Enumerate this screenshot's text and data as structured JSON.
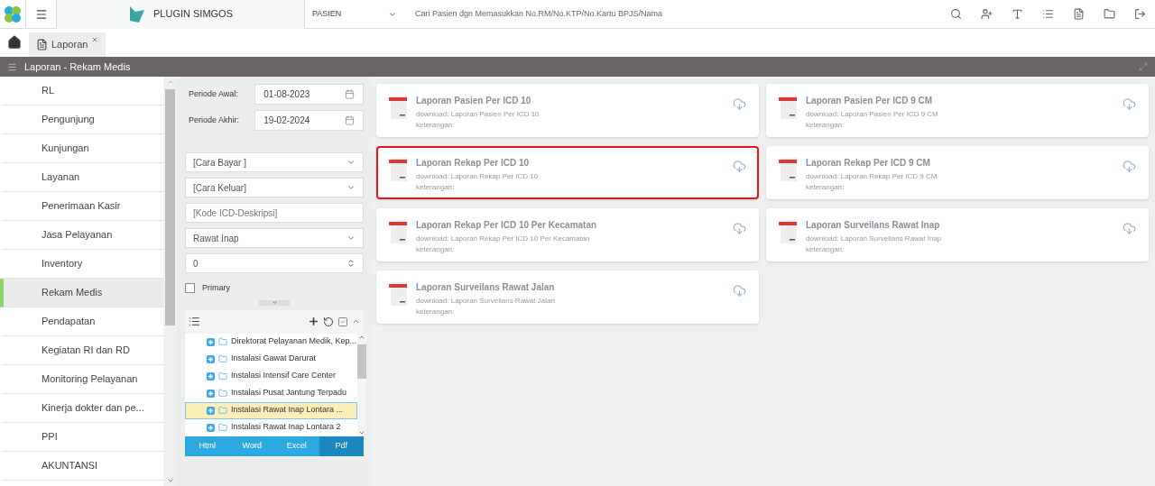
{
  "header": {
    "app_title": "PLUGIN SIMGOS",
    "search_type": "PASIEN",
    "search_placeholder": "Cari Pasien dgn Memasukkan No.RM/No.KTP/No.Kartu BPJS/Nama"
  },
  "tabs": [
    {
      "label": "Laporan",
      "selected": true
    }
  ],
  "panel_title": "Laporan - Rekam Medis",
  "sidebar": {
    "items": [
      {
        "label": "RL",
        "selected": false
      },
      {
        "label": "Pengunjung",
        "selected": false
      },
      {
        "label": "Kunjungan",
        "selected": false
      },
      {
        "label": "Layanan",
        "selected": false
      },
      {
        "label": "Penerimaan Kasir",
        "selected": false
      },
      {
        "label": "Jasa Pelayanan",
        "selected": false
      },
      {
        "label": "Inventory",
        "selected": false
      },
      {
        "label": "Rekam Medis",
        "selected": true
      },
      {
        "label": "Pendapatan",
        "selected": false
      },
      {
        "label": "Kegiatan RI dan RD",
        "selected": false
      },
      {
        "label": "Monitoring Pelayanan",
        "selected": false
      },
      {
        "label": "Kinerja dokter dan pe...",
        "selected": false
      },
      {
        "label": "PPI",
        "selected": false
      },
      {
        "label": "AKUNTANSI",
        "selected": false
      }
    ]
  },
  "filters": {
    "dates": [
      {
        "label": "Periode Awal:",
        "value": "01-08-2023"
      },
      {
        "label": "Periode Akhir:",
        "value": "19-02-2024"
      }
    ],
    "fields": [
      {
        "kind": "select",
        "placeholder": "[Cara Bayar ]"
      },
      {
        "kind": "select",
        "placeholder": "[Cara Keluar]"
      },
      {
        "kind": "text",
        "placeholder": "[Kode ICD-Deskripsi]"
      },
      {
        "kind": "select",
        "value": "Rawat Inap"
      },
      {
        "kind": "number",
        "value": "0"
      }
    ],
    "primary": {
      "label": "Primary",
      "checked": false
    }
  },
  "tree": {
    "items": [
      {
        "label": "Direktorat Pelayanan Medik, Kep...",
        "selected": false
      },
      {
        "label": "Instalasi Gawat Darurat",
        "selected": false
      },
      {
        "label": "Instalasi Intensif Care Center",
        "selected": false
      },
      {
        "label": "Instalasi Pusat Jantung Terpadu",
        "selected": false
      },
      {
        "label": "Instalasi Rawat Inap Lontara ...",
        "selected": true
      },
      {
        "label": "Instalasi Rawat Inap Lontara 2",
        "selected": false
      }
    ]
  },
  "formats": [
    {
      "label": "Html",
      "selected": false
    },
    {
      "label": "Word",
      "selected": false
    },
    {
      "label": "Excel",
      "selected": false
    },
    {
      "label": "Pdf",
      "selected": true
    }
  ],
  "reports": [
    {
      "title": "Laporan Pasien Per ICD 10",
      "download": "download: Laporan Pasien Per ICD 10",
      "note": "keterangan:",
      "selected": false
    },
    {
      "title": "Laporan Pasien Per ICD 9 CM",
      "download": "download: Laporan Pasien Per ICD 9 CM",
      "note": "keterangan:",
      "selected": false
    },
    {
      "title": "Laporan Rekap Per ICD 10",
      "download": "download: Laporan Rekap Per ICD 10",
      "note": "keterangan:",
      "selected": true
    },
    {
      "title": "Laporan Rekap Per ICD 9 CM",
      "download": "download: Laporan Rekap Per ICD 9 CM",
      "note": "keterangan:",
      "selected": false
    },
    {
      "title": "Laporan Rekap Per ICD 10 Per Kecamatan",
      "download": "download: Laporan Rekap Per ICD 10 Per Kecamatan",
      "note": "keterangan:",
      "selected": false
    },
    {
      "title": "Laporan Surveilans Rawat Inap",
      "download": "download: Laporan Surveilans Rawat Inap",
      "note": "keterangan:",
      "selected": false
    },
    {
      "title": "Laporan Surveilans Rawat Jalan",
      "download": "download: Laporan Surveilans Rawat Jalan",
      "note": "keterangan:",
      "selected": false
    }
  ]
}
